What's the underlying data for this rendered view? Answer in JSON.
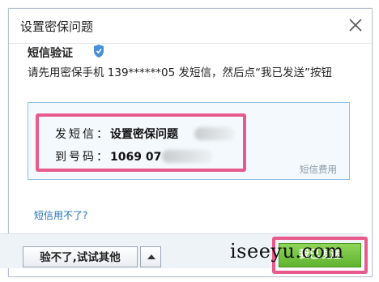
{
  "window": {
    "title": "设置密保问题"
  },
  "main": {
    "heading": "短信验证",
    "instructions": "请先用密保手机 139******05 发短信，然后点“我已发送”按钮",
    "sms": {
      "send_label": "发短信：",
      "send_value": "设置密保问题",
      "to_label": "到号码：",
      "to_value": "1069 07",
      "fee_note": "短信费用"
    },
    "help_link": "短信用不了?"
  },
  "footer": {
    "alt_button": "验不了,试试其他",
    "confirm_button": "我已发送"
  },
  "watermark": "iseeyu.com",
  "colors": {
    "highlight": "#e85a8c",
    "confirm": "#5fb32e",
    "link": "#1e6fb8"
  }
}
